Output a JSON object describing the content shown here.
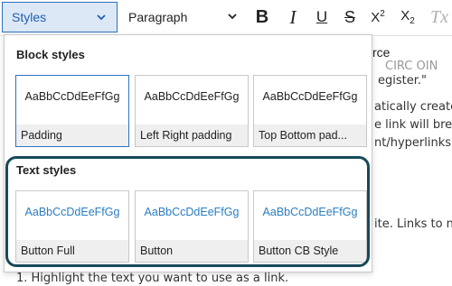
{
  "toolbar": {
    "styles_label": "Styles",
    "paragraph_label": "Paragraph",
    "bold": "B",
    "italic": "I",
    "underline": "U",
    "strikethrough": "S",
    "superscript_base": "X",
    "superscript_mark": "2",
    "subscript_base": "X",
    "subscript_mark": "2",
    "clear_format": "Tx"
  },
  "document": {
    "source_fragment": "rce",
    "line1": "CIRC OIN",
    "line2": "egister.\"",
    "line3": "atically create",
    "line4": "e link will brea",
    "line5": "nt/hyperlinks i",
    "line6": "ite. Links to n",
    "line7": "1. Highlight the text you want to use as a link."
  },
  "panel": {
    "block_heading": "Block styles",
    "text_heading": "Text styles",
    "preview_text": "AaBbCcDdEeFfGg",
    "block_styles": [
      {
        "label": "Padding"
      },
      {
        "label": "Left Right padding"
      },
      {
        "label": "Top Bottom pad..."
      }
    ],
    "text_styles": [
      {
        "label": "Button Full"
      },
      {
        "label": "Button"
      },
      {
        "label": "Button CB Style"
      }
    ]
  },
  "colors": {
    "accent": "#2d6fbe",
    "link_preview": "#2a7dc2",
    "highlight_ring": "#17495a"
  }
}
